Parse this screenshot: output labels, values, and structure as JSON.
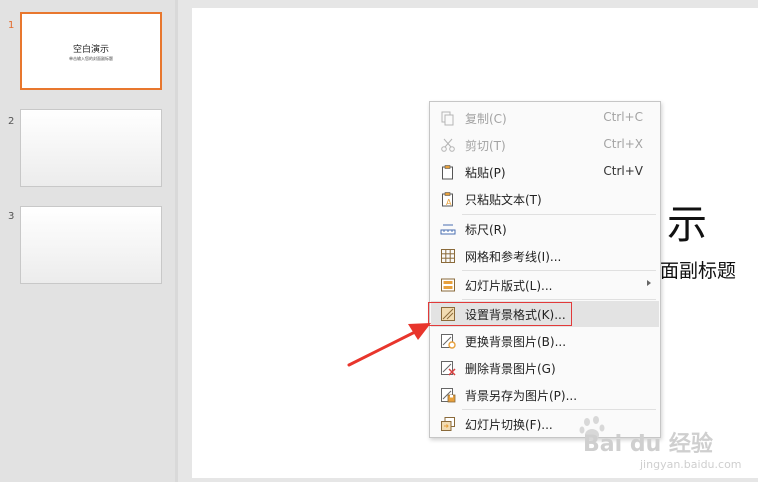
{
  "slides": [
    {
      "number": "1",
      "title": "空白演示",
      "subtitle": "单击输入您的封面副标题",
      "active": true
    },
    {
      "number": "2",
      "title": "",
      "subtitle": "",
      "active": false
    },
    {
      "number": "3",
      "title": "",
      "subtitle": "",
      "active": false
    }
  ],
  "canvas": {
    "title_visible": "示",
    "subtitle_visible": "面副标题"
  },
  "context_menu": {
    "items": [
      {
        "label": "复制(C)",
        "shortcut": "Ctrl+C",
        "icon": "copy-icon",
        "enabled": false
      },
      {
        "label": "剪切(T)",
        "shortcut": "Ctrl+X",
        "icon": "cut-icon",
        "enabled": false
      },
      {
        "label": "粘贴(P)",
        "shortcut": "Ctrl+V",
        "icon": "paste-icon",
        "enabled": true
      },
      {
        "label": "只粘贴文本(T)",
        "shortcut": "",
        "icon": "paste-text-icon",
        "enabled": true
      },
      {
        "label": "标尺(R)",
        "shortcut": "",
        "icon": "ruler-icon",
        "enabled": true
      },
      {
        "label": "网格和参考线(I)...",
        "shortcut": "",
        "icon": "grid-icon",
        "enabled": true
      },
      {
        "label": "幻灯片版式(L)...",
        "shortcut": "",
        "icon": "layout-icon",
        "enabled": true,
        "submenu": true
      },
      {
        "label": "设置背景格式(K)...",
        "shortcut": "",
        "icon": "background-format-icon",
        "enabled": true,
        "highlighted": true
      },
      {
        "label": "更换背景图片(B)...",
        "shortcut": "",
        "icon": "change-background-icon",
        "enabled": true
      },
      {
        "label": "删除背景图片(G)",
        "shortcut": "",
        "icon": "delete-background-icon",
        "enabled": true
      },
      {
        "label": "背景另存为图片(P)...",
        "shortcut": "",
        "icon": "save-background-icon",
        "enabled": true
      },
      {
        "label": "幻灯片切换(F)...",
        "shortcut": "",
        "icon": "transition-icon",
        "enabled": true
      }
    ]
  },
  "colors": {
    "active_thumb_border": "#e8772e",
    "highlight_box": "#e23a3a",
    "annotation_arrow": "#e8352c"
  },
  "watermark": {
    "brand": "Bai du 经验",
    "url": "jingyan.baidu.com"
  }
}
